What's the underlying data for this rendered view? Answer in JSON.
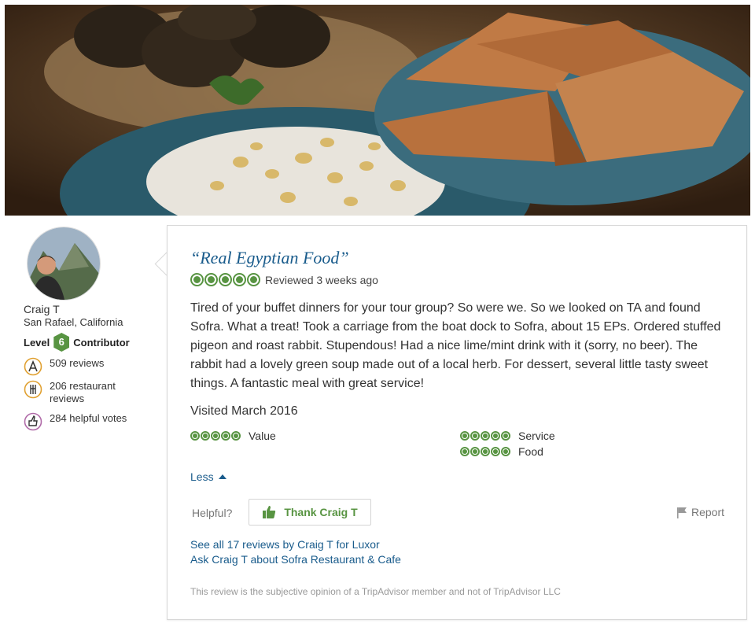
{
  "reviewer": {
    "name": "Craig T",
    "location": "San Rafael, California",
    "level_prefix": "Level",
    "level_number": "6",
    "level_suffix": "Contributor",
    "stats": [
      {
        "icon": "pen-badge-icon",
        "text": "509 reviews"
      },
      {
        "icon": "fork-knife-badge-icon",
        "text": "206 restaurant reviews"
      },
      {
        "icon": "thumbs-up-badge-icon",
        "text": "284 helpful votes"
      }
    ]
  },
  "review": {
    "title": "“Real Egyptian Food”",
    "rating": 5,
    "reviewed_date": "Reviewed 3 weeks ago",
    "text": "Tired of your buffet dinners for your tour group? So were we. So we looked on TA and found Sofra. What a treat! Took a carriage from the boat dock to Sofra, about 15 EPs. Ordered stuffed pigeon and roast rabbit. Stupendous! Had a nice lime/mint drink with it (sorry, no beer). The rabbit had a lovely green soup made out of a local herb. For dessert, several little tasty sweet things. A fantastic meal with great service!",
    "visited": "Visited March 2016",
    "subratings": [
      {
        "label": "Value",
        "rating": 5
      },
      {
        "label": "Service",
        "rating": 5
      },
      {
        "label": "Food",
        "rating": 5
      }
    ],
    "less_label": "Less",
    "helpful_label": "Helpful?",
    "thank_label": "Thank Craig T",
    "report_label": "Report",
    "see_all_link": "See all 17 reviews by Craig T for Luxor",
    "ask_link": "Ask Craig T about Sofra Restaurant & Cafe",
    "disclaimer": "This review is the subjective opinion of a TripAdvisor member and not of TripAdvisor LLC"
  },
  "colors": {
    "brand_green": "#589442",
    "link_blue": "#1a5c8c"
  }
}
